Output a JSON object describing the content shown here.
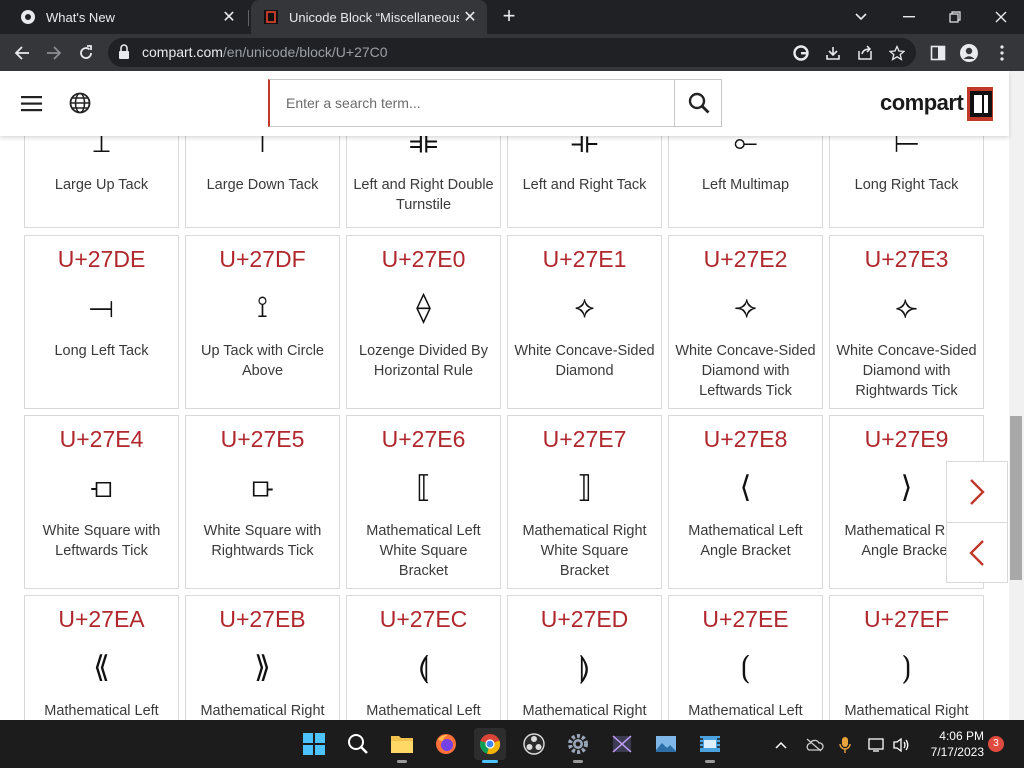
{
  "browser": {
    "tabs": [
      {
        "title": "What's New",
        "active": false,
        "icon": "chrome-icon"
      },
      {
        "title": "Unicode Block “Miscellaneous Ma",
        "active": true,
        "icon": "compart-favicon"
      }
    ],
    "url": {
      "host": "compart.com",
      "path": "/en/unicode/block/U+27C0"
    }
  },
  "site": {
    "search_placeholder": "Enter a search term...",
    "logo_text": "compart",
    "accent": "#b0282e"
  },
  "cards": [
    {
      "code": "",
      "glyph": "⟘",
      "name": "Large Up Tack"
    },
    {
      "code": "",
      "glyph": "⟙",
      "name": "Large Down Tack"
    },
    {
      "code": "",
      "glyph": "⟚",
      "name": "Left and Right Double Turnstile"
    },
    {
      "code": "",
      "glyph": "⟛",
      "name": "Left and Right Tack"
    },
    {
      "code": "",
      "glyph": "⟜",
      "name": "Left Multimap"
    },
    {
      "code": "",
      "glyph": "⟝",
      "name": "Long Right Tack"
    },
    {
      "code": "U+27DE",
      "glyph": "⟞",
      "name": "Long Left Tack"
    },
    {
      "code": "U+27DF",
      "glyph": "⟟",
      "name": "Up Tack with Circle Above"
    },
    {
      "code": "U+27E0",
      "glyph": "⟠",
      "name": "Lozenge Divided By Horizontal Rule"
    },
    {
      "code": "U+27E1",
      "glyph": "⟡",
      "name": "White Concave-Sided Diamond"
    },
    {
      "code": "U+27E2",
      "glyph": "⟢",
      "name": "White Concave-Sided Diamond with Leftwards Tick"
    },
    {
      "code": "U+27E3",
      "glyph": "⟣",
      "name": "White Concave-Sided Diamond with Rightwards Tick"
    },
    {
      "code": "U+27E4",
      "glyph": "⟤",
      "name": "White Square with Leftwards Tick"
    },
    {
      "code": "U+27E5",
      "glyph": "⟥",
      "name": "White Square with Rightwards Tick"
    },
    {
      "code": "U+27E6",
      "glyph": "⟦",
      "name": "Mathematical Left White Square Bracket"
    },
    {
      "code": "U+27E7",
      "glyph": "⟧",
      "name": "Mathematical Right White Square Bracket"
    },
    {
      "code": "U+27E8",
      "glyph": "⟨",
      "name": "Mathematical Left Angle Bracket"
    },
    {
      "code": "U+27E9",
      "glyph": "⟩",
      "name": "Mathematical Right Angle Bracket"
    },
    {
      "code": "U+27EA",
      "glyph": "⟪",
      "name": "Mathematical Left"
    },
    {
      "code": "U+27EB",
      "glyph": "⟫",
      "name": "Mathematical Right"
    },
    {
      "code": "U+27EC",
      "glyph": "⟬",
      "name": "Mathematical Left"
    },
    {
      "code": "U+27ED",
      "glyph": "⟭",
      "name": "Mathematical Right"
    },
    {
      "code": "U+27EE",
      "glyph": "⟮",
      "name": "Mathematical Left"
    },
    {
      "code": "U+27EF",
      "glyph": "⟯",
      "name": "Mathematical Right"
    }
  ],
  "taskbar": {
    "apps": [
      "windows-start-icon",
      "search-icon",
      "file-explorer-icon",
      "firefox-icon",
      "chrome-icon",
      "obs-icon",
      "settings-icon",
      "media-player-icon",
      "photos-icon",
      "film-editor-icon"
    ],
    "time": "4:06 PM",
    "date": "7/17/2023",
    "notification_count": "3"
  }
}
